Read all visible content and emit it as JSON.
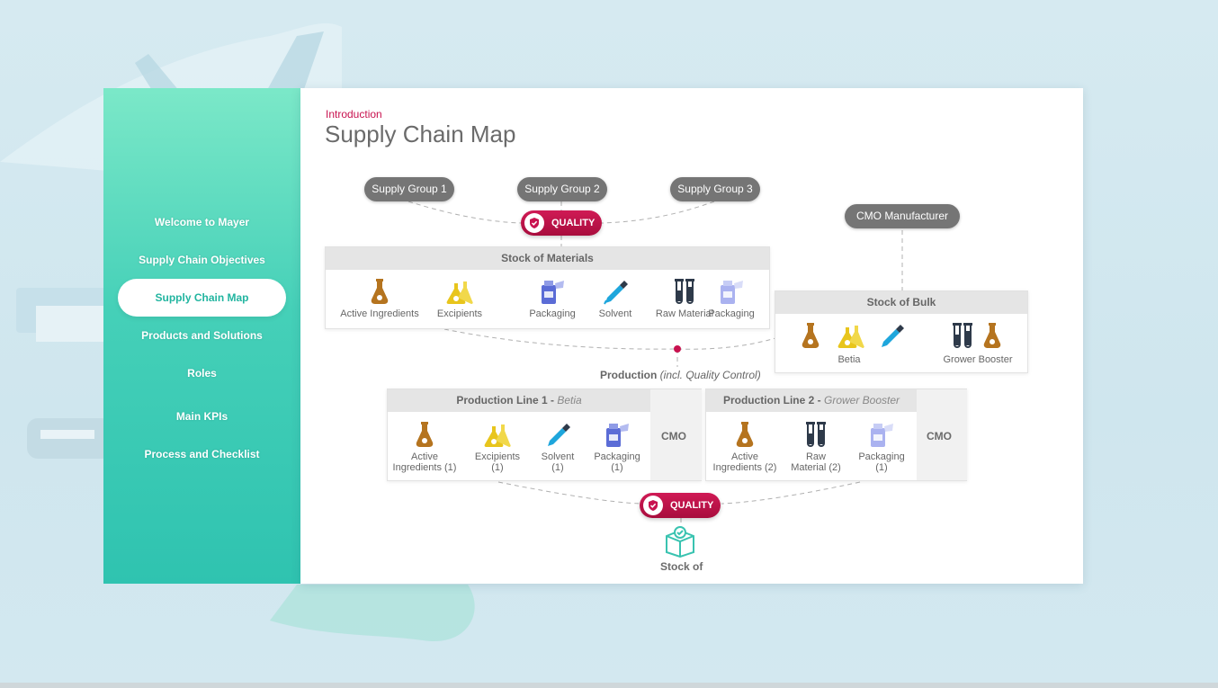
{
  "nav": {
    "items": [
      {
        "label": "Welcome to Mayer"
      },
      {
        "label": "Supply Chain Objectives"
      },
      {
        "label": "Supply Chain Map",
        "active": true
      },
      {
        "label": "Products and Solutions"
      },
      {
        "label": "Roles"
      },
      {
        "label": "Main KPIs"
      },
      {
        "label": "Process and Checklist"
      }
    ]
  },
  "header": {
    "section": "Introduction",
    "title": "Supply Chain Map"
  },
  "supply_groups": [
    "Supply Group 1",
    "Supply Group 2",
    "Supply Group 3"
  ],
  "quality_label": "QUALITY",
  "cmo_manufacturer": "CMO Manufacturer",
  "stock_materials": {
    "title": "Stock of Materials",
    "items": [
      {
        "label": "Active Ingredients",
        "icon": "flask-icon"
      },
      {
        "label": "Excipients",
        "icon": "excipients-icon"
      },
      {
        "label": "Packaging",
        "icon": "packaging-icon"
      },
      {
        "label": "Solvent",
        "icon": "pipette-icon"
      },
      {
        "label": "Raw Material",
        "icon": "test-tubes-icon"
      },
      {
        "label": "Packaging",
        "icon": "packaging-light-icon"
      }
    ]
  },
  "stock_bulk": {
    "title": "Stock of Bulk",
    "labels": [
      "Betia",
      "Grower Booster"
    ]
  },
  "production": {
    "label": "Production",
    "sub": "(incl. Quality Control)"
  },
  "line1": {
    "title": "Production Line 1",
    "product": "Betia",
    "cmo": "CMO",
    "items": [
      {
        "l1": "Active",
        "l2": "Ingredients (1)"
      },
      {
        "l1": "Excipients",
        "l2": "(1)"
      },
      {
        "l1": "Solvent",
        "l2": "(1)"
      },
      {
        "l1": "Packaging",
        "l2": "(1)"
      }
    ]
  },
  "line2": {
    "title": "Production Line 2",
    "product": "Grower Booster",
    "cmo": "CMO",
    "items": [
      {
        "l1": "Active",
        "l2": "Ingredients (2)"
      },
      {
        "l1": "Raw",
        "l2": "Material (2)"
      },
      {
        "l1": "Packaging",
        "l2": "(1)"
      }
    ]
  },
  "stock_final": "Stock of",
  "colors": {
    "accent": "#c8124f",
    "teal": "#22b5a0",
    "flask": "#b5741f",
    "excipients": "#e8c51c",
    "packaging": "#5b6cd6",
    "solvent": "#1ea6dc",
    "tubes": "#2e3a4a"
  }
}
